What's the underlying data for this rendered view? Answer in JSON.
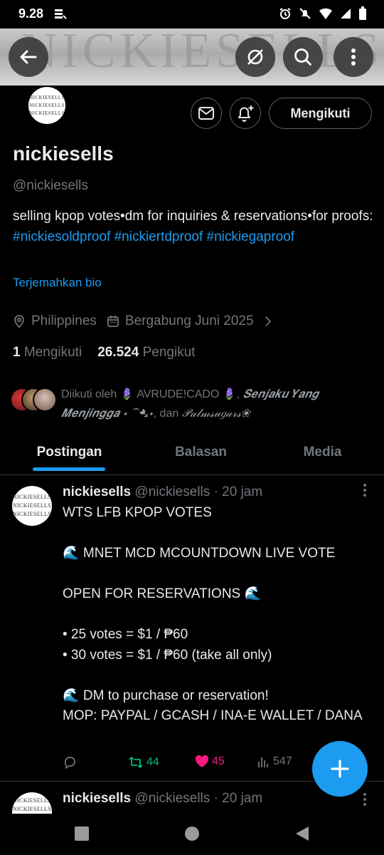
{
  "status_bar": {
    "time": "9.28"
  },
  "banner": {
    "text": "NICKIESELLS"
  },
  "profile": {
    "avatar_lines": [
      "NICKIESELLS",
      "NICKIESELLS",
      "NICKIESELLS"
    ],
    "follow_label": "Mengikuti",
    "name": "nickiesells",
    "handle": "@nickiesells",
    "bio_text": "selling kpop votes•dm for inquiries & reservations•for proofs: ",
    "bio_tags": [
      "#nickiesoldproof",
      "#nickiertdproof",
      "#nickiegaproof"
    ],
    "translate_label": "Terjemahkan bio",
    "location": "Philippines",
    "joined": "Bergabung Juni 2025",
    "following_count": "1",
    "following_label": "Mengikuti",
    "followers_count": "26.524",
    "followers_label": "Pengikut",
    "followed_by_prefix": "Diikuti oleh",
    "followed_by_1": "🪻 AVRUDE!CADO 🪻",
    "followed_by_2": "𝑺𝒆𝒏𝒋𝒂𝒌𝒖 𝒀𝒂𝒏𝒈 𝑴𝒆𝒏𝒋𝒊𝒏𝒈𝒈𝒂 ⋆ ⁀➷⋆",
    "followed_by_and": "dan",
    "followed_by_3": "𝒫𝒶𝓁𝓂𝓈𝓊𝑔𝒶𝓇𝓈❀"
  },
  "tabs": [
    "Postingan",
    "Balasan",
    "Media"
  ],
  "posts": [
    {
      "name": "nickiesells",
      "handle": "@nickiesells",
      "time": "· 20 jam",
      "body": "WTS LFB KPOP VOTES\n\n🌊 MNET MCD MCOUNTDOWN LIVE VOTE\n\nOPEN FOR RESERVATIONS 🌊\n\n• 25 votes = $1 / ₱60\n• 30 votes = $1 / ₱60 (take all only)\n\n🌊 DM to purchase or reservation!\nMOP: PAYPAL / GCASH / INA-E WALLET / DANA",
      "retweets": "44",
      "likes": "45",
      "views": "547"
    },
    {
      "name": "nickiesells",
      "handle": "@nickiesells",
      "time": "· 20 jam"
    }
  ],
  "colors": {
    "accent": "#1d9bf0",
    "like": "#f91880",
    "retweet": "#00ba7c",
    "muted": "#71767b"
  }
}
